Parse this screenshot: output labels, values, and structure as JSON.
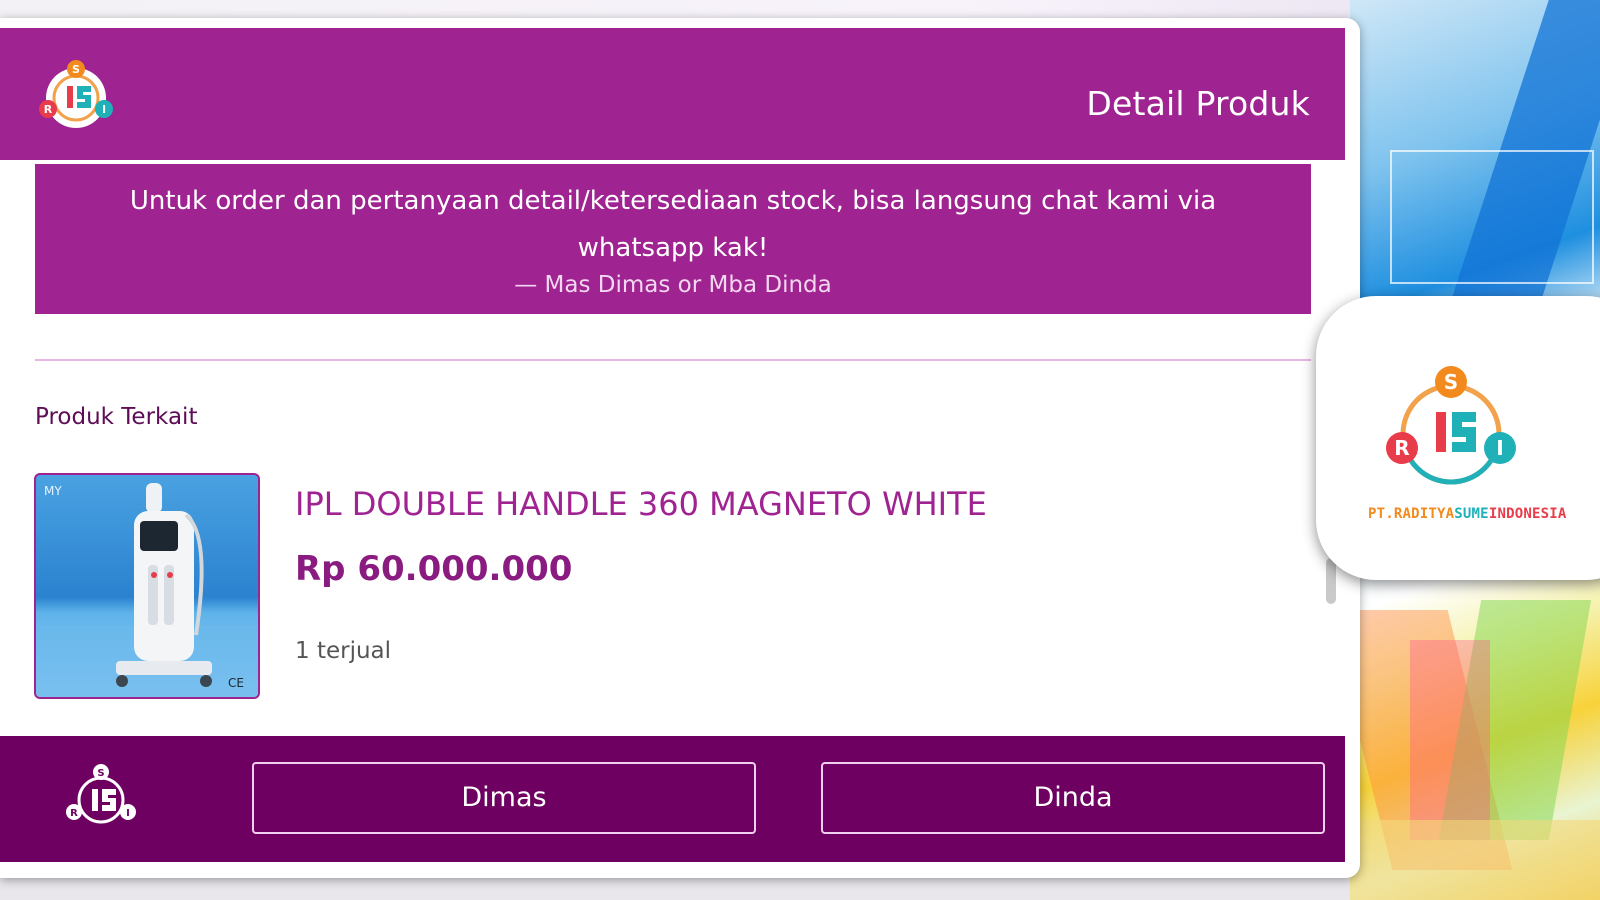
{
  "header": {
    "title": "Detail Produk",
    "logo_icon": "rsi-logo-icon"
  },
  "notice": {
    "text": "Untuk order dan pertanyaan detail/ketersediaan stock, bisa langsung chat kami via whatsapp kak!",
    "author": "— Mas Dimas or Mba Dinda"
  },
  "related": {
    "label": "Produk Terkait",
    "items": [
      {
        "name": "IPL DOUBLE HANDLE 360 MAGNETO WHITE",
        "price": "Rp 60.000.000",
        "sold": "1 terjual",
        "image_icon": "ipl-machine-image"
      }
    ]
  },
  "footer": {
    "logo_icon": "rsi-logo-white-icon",
    "buttons": [
      {
        "label": "Dimas"
      },
      {
        "label": "Dinda"
      }
    ]
  },
  "side_card": {
    "caption_part1": "PT.RADITYA",
    "caption_part2": "SUME",
    "caption_part3": "INDONESIA"
  },
  "colors": {
    "primary": "#9f2391",
    "footer": "#6d0061",
    "divider": "#e8b6e3"
  }
}
